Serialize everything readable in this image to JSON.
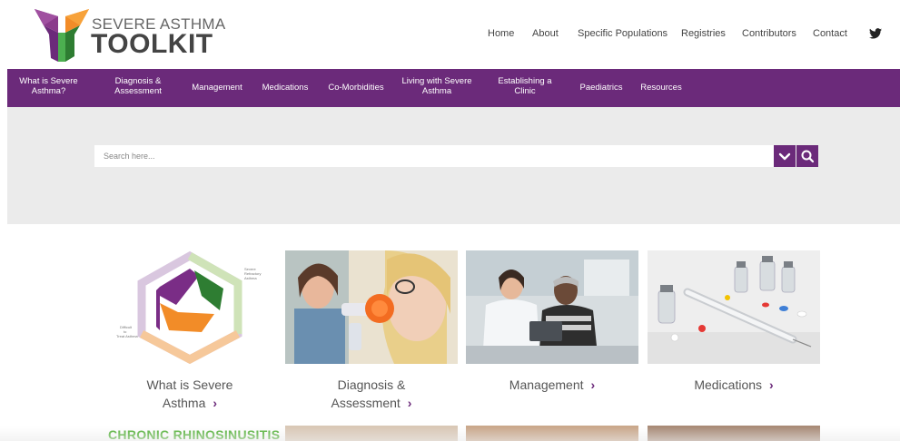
{
  "brand": {
    "line1": "SEVERE ASTHMA",
    "line2": "TOOLKIT"
  },
  "topnav": [
    "Home",
    "About",
    "Specific Populations",
    "Registries",
    "Contributors",
    "Contact"
  ],
  "mainnav": [
    "What is Severe\nAsthma?",
    "Diagnosis &\nAssessment",
    "Management",
    "Medications",
    "Co-Morbidities",
    "Living with Severe\nAsthma",
    "Establishing a\nClinic",
    "Paediatrics",
    "Resources"
  ],
  "search": {
    "placeholder": "Search here..."
  },
  "cards": [
    {
      "title_line1": "What is Severe",
      "title_line2": "Asthma",
      "image": "severe-asthma-hexagon-diagram"
    },
    {
      "title_line1": "Diagnosis &",
      "title_line2": "Assessment",
      "image": "spirometry-test-photo"
    },
    {
      "title_line1": "Management",
      "title_line2": "",
      "image": "doctor-patient-tablet-photo"
    },
    {
      "title_line1": "Medications",
      "title_line2": "",
      "image": "vials-syringe-pills-photo"
    }
  ],
  "row2": {
    "chronic_label": "CHRONIC RHINOSINUSITIS"
  },
  "colors": {
    "purple": "#6b2a7a",
    "green": "#4caf2f",
    "search_band": "#ebebeb"
  },
  "icons": [
    "twitter-icon",
    "chevron-down-icon",
    "search-icon",
    "chevron-right-icon"
  ]
}
